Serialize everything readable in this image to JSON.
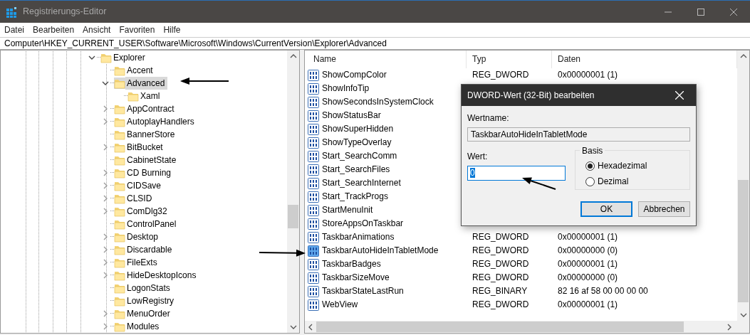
{
  "window": {
    "title": "Registrierungs-Editor"
  },
  "menu": [
    "Datei",
    "Bearbeiten",
    "Ansicht",
    "Favoriten",
    "Hilfe"
  ],
  "address": "Computer\\HKEY_CURRENT_USER\\Software\\Microsoft\\Windows\\CurrentVersion\\Explorer\\Advanced",
  "tree": [
    {
      "label": "Explorer",
      "has_children": true,
      "expanded": true,
      "selected": false,
      "children": [
        {
          "label": "Accent",
          "has_children": false,
          "expanded": false,
          "selected": false
        },
        {
          "label": "Advanced",
          "has_children": true,
          "expanded": true,
          "selected": true,
          "children": [
            {
              "label": "Xaml",
              "has_children": false,
              "expanded": false,
              "selected": false
            }
          ]
        },
        {
          "label": "AppContract",
          "has_children": true,
          "expanded": false,
          "selected": false
        },
        {
          "label": "AutoplayHandlers",
          "has_children": true,
          "expanded": false,
          "selected": false
        },
        {
          "label": "BannerStore",
          "has_children": false,
          "expanded": false,
          "selected": false
        },
        {
          "label": "BitBucket",
          "has_children": true,
          "expanded": false,
          "selected": false
        },
        {
          "label": "CabinetState",
          "has_children": false,
          "expanded": false,
          "selected": false
        },
        {
          "label": "CD Burning",
          "has_children": true,
          "expanded": false,
          "selected": false
        },
        {
          "label": "CIDSave",
          "has_children": true,
          "expanded": false,
          "selected": false
        },
        {
          "label": "CLSID",
          "has_children": true,
          "expanded": false,
          "selected": false
        },
        {
          "label": "ComDlg32",
          "has_children": true,
          "expanded": false,
          "selected": false
        },
        {
          "label": "ControlPanel",
          "has_children": false,
          "expanded": false,
          "selected": false
        },
        {
          "label": "Desktop",
          "has_children": true,
          "expanded": false,
          "selected": false
        },
        {
          "label": "Discardable",
          "has_children": true,
          "expanded": false,
          "selected": false
        },
        {
          "label": "FileExts",
          "has_children": true,
          "expanded": false,
          "selected": false
        },
        {
          "label": "HideDesktopIcons",
          "has_children": true,
          "expanded": false,
          "selected": false
        },
        {
          "label": "LogonStats",
          "has_children": false,
          "expanded": false,
          "selected": false
        },
        {
          "label": "LowRegistry",
          "has_children": false,
          "expanded": false,
          "selected": false
        },
        {
          "label": "MenuOrder",
          "has_children": true,
          "expanded": false,
          "selected": false
        },
        {
          "label": "Modules",
          "has_children": true,
          "expanded": false,
          "selected": false
        }
      ]
    }
  ],
  "table": {
    "columns": [
      "Name",
      "Typ",
      "Daten"
    ],
    "rows": [
      {
        "name": "ShowCompColor",
        "type": "REG_DWORD",
        "data": "0x00000001 (1)",
        "selected": false
      },
      {
        "name": "ShowInfoTip",
        "selected": false
      },
      {
        "name": "ShowSecondsInSystemClock",
        "selected": false
      },
      {
        "name": "ShowStatusBar",
        "selected": false
      },
      {
        "name": "ShowSuperHidden",
        "selected": false
      },
      {
        "name": "ShowTypeOverlay",
        "selected": false
      },
      {
        "name": "Start_SearchComm",
        "selected": false
      },
      {
        "name": "Start_SearchFiles",
        "selected": false
      },
      {
        "name": "Start_SearchInternet",
        "selected": false
      },
      {
        "name": "Start_TrackProgs",
        "selected": false
      },
      {
        "name": "StartMenuInit",
        "selected": false
      },
      {
        "name": "StoreAppsOnTaskbar",
        "selected": false
      },
      {
        "name": "TaskbarAnimations",
        "type": "REG_DWORD",
        "data": "0x00000001 (1)",
        "selected": false
      },
      {
        "name": "TaskbarAutoHideInTabletMode",
        "type": "REG_DWORD",
        "data": "0x00000000 (0)",
        "selected": true
      },
      {
        "name": "TaskbarBadges",
        "type": "REG_DWORD",
        "data": "0x00000001 (1)",
        "selected": false
      },
      {
        "name": "TaskbarSizeMove",
        "type": "REG_DWORD",
        "data": "0x00000000 (0)",
        "selected": false
      },
      {
        "name": "TaskbarStateLastRun",
        "type": "REG_BINARY",
        "data": "82 16 af 58 00 00 00 00",
        "selected": false
      },
      {
        "name": "WebView",
        "type": "REG_DWORD",
        "data": "0x00000001 (1)",
        "selected": false
      }
    ]
  },
  "dialog": {
    "title": "DWORD-Wert (32-Bit) bearbeiten",
    "name_label": "Wertname:",
    "name_value": "TaskbarAutoHideInTabletMode",
    "value_label": "Wert:",
    "value": "0",
    "base_label": "Basis",
    "bases": [
      {
        "label": "Hexadezimal",
        "selected": true
      },
      {
        "label": "Dezimal",
        "selected": false
      }
    ],
    "buttons": [
      {
        "label": "OK",
        "default": true
      },
      {
        "label": "Abbrechen",
        "default": false
      }
    ]
  }
}
